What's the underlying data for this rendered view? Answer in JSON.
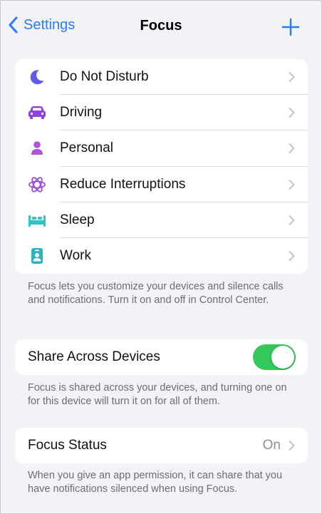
{
  "nav": {
    "back_label": "Settings",
    "title": "Focus"
  },
  "focus_modes": [
    {
      "label": "Do Not Disturb",
      "icon": "moon-icon",
      "color": "#5e5ce6"
    },
    {
      "label": "Driving",
      "icon": "car-icon",
      "color": "#8e44d8"
    },
    {
      "label": "Personal",
      "icon": "person-icon",
      "color": "#af52de"
    },
    {
      "label": "Reduce Interruptions",
      "icon": "atom-icon",
      "color": "#9b4fe0"
    },
    {
      "label": "Sleep",
      "icon": "bed-icon",
      "color": "#30c4c9"
    },
    {
      "label": "Work",
      "icon": "id-badge-icon",
      "color": "#2cb3c2"
    }
  ],
  "focus_footnote": "Focus lets you customize your devices and silence calls and notifications. Turn it on and off in Control Center.",
  "share": {
    "label": "Share Across Devices",
    "enabled": true,
    "footnote": "Focus is shared across your devices, and turning one on for this device will turn it on for all of them."
  },
  "status": {
    "label": "Focus Status",
    "value": "On",
    "footnote": "When you give an app permission, it can share that you have notifications silenced when using Focus."
  },
  "colors": {
    "accent": "#2a7bf6",
    "toggle_on": "#34c759",
    "background": "#f2f2f7"
  }
}
